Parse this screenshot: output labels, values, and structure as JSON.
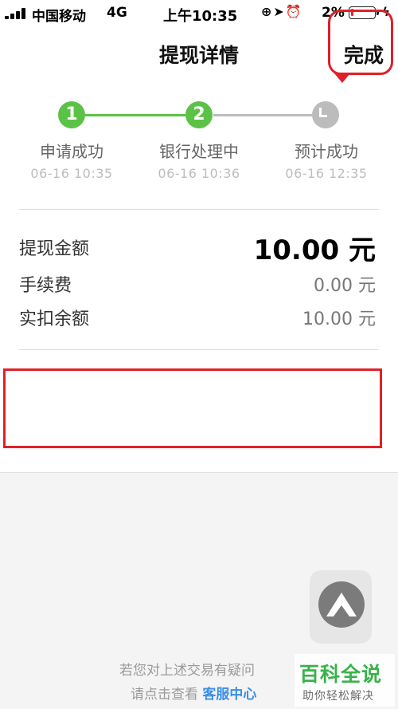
{
  "status_bar": {
    "carrier": "中国移动",
    "network": "4G",
    "time": "上午10:35",
    "battery_percent": "2%",
    "icons": [
      "orientation-lock-icon",
      "location-icon",
      "alarm-icon",
      "charging-icon"
    ]
  },
  "nav": {
    "title": "提现详情",
    "done_label": "完成"
  },
  "steps": [
    {
      "number": "1",
      "label": "申请成功",
      "time": "06-16 10:35",
      "state": "done",
      "color": "#5cc247"
    },
    {
      "number": "2",
      "label": "银行处理中",
      "time": "06-16 10:36",
      "state": "current",
      "color": "#5cc247"
    },
    {
      "number": "",
      "label": "预计成功",
      "time": "06-16 12:35",
      "state": "pending",
      "color": "#bcbcbc",
      "icon": "clock-icon"
    }
  ],
  "amounts": [
    {
      "label": "提现金额",
      "value": "10.00 元"
    },
    {
      "label": "手续费",
      "value": "0.00 元"
    },
    {
      "label": "实扣余额",
      "value": "10.00 元"
    }
  ],
  "help": {
    "line1": "若您对上述交易有疑问",
    "line2_prefix": "请点击查看",
    "link": "客服中心"
  },
  "watermark": {
    "title": "百科全说",
    "subtitle": "助你轻松解决"
  },
  "colors": {
    "accent_green": "#5cc247",
    "annotation_red": "#e02028",
    "link_blue": "#3a8ee6"
  }
}
